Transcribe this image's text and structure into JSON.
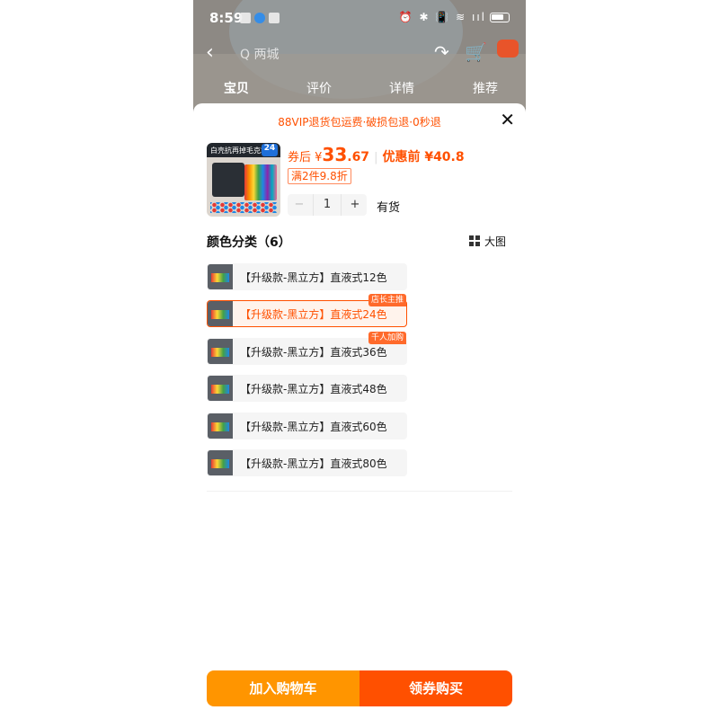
{
  "status_bar": {
    "time": "8:59",
    "right_glyphs": "⏰ ✱ 📳 ≋ ııl"
  },
  "top_nav": {
    "back": "‹",
    "search_placeholder": "Q 两城",
    "share": "↷",
    "cart": "🛒"
  },
  "tabs": [
    "宝贝",
    "评价",
    "详情",
    "推荐"
  ],
  "sheet": {
    "promo": "88VIP退货包运费·破损包退·0秒退",
    "close": "✕"
  },
  "product": {
    "thumb_banner": "白壳抗再掉毛克笔",
    "thumb_num": "24",
    "price_prefix": "券后 ¥",
    "price_int": "33",
    "price_dec": ".67",
    "price_sep": "|",
    "orig_label": "优惠前 ¥40.8",
    "discount": "满2件9.8折",
    "quantity": "1",
    "minus": "−",
    "plus": "+",
    "stock": "有货"
  },
  "options_section": {
    "title": "颜色分类（6）",
    "big_view": "大图",
    "options": [
      {
        "label": "【升级款-黑立方】直液式12色",
        "badge": ""
      },
      {
        "label": "【升级款-黑立方】直液式24色",
        "badge": "店长主推"
      },
      {
        "label": "【升级款-黑立方】直液式36色",
        "badge": "千人加购"
      },
      {
        "label": "【升级款-黑立方】直液式48色",
        "badge": ""
      },
      {
        "label": "【升级款-黑立方】直液式60色",
        "badge": ""
      },
      {
        "label": "【升级款-黑立方】直液式80色",
        "badge": ""
      }
    ],
    "selected_index": 1
  },
  "actions": {
    "add_to_cart": "加入购物车",
    "buy": "领券购买"
  },
  "colors": {
    "accent": "#ff5000",
    "cart_button": "#ff9500"
  }
}
